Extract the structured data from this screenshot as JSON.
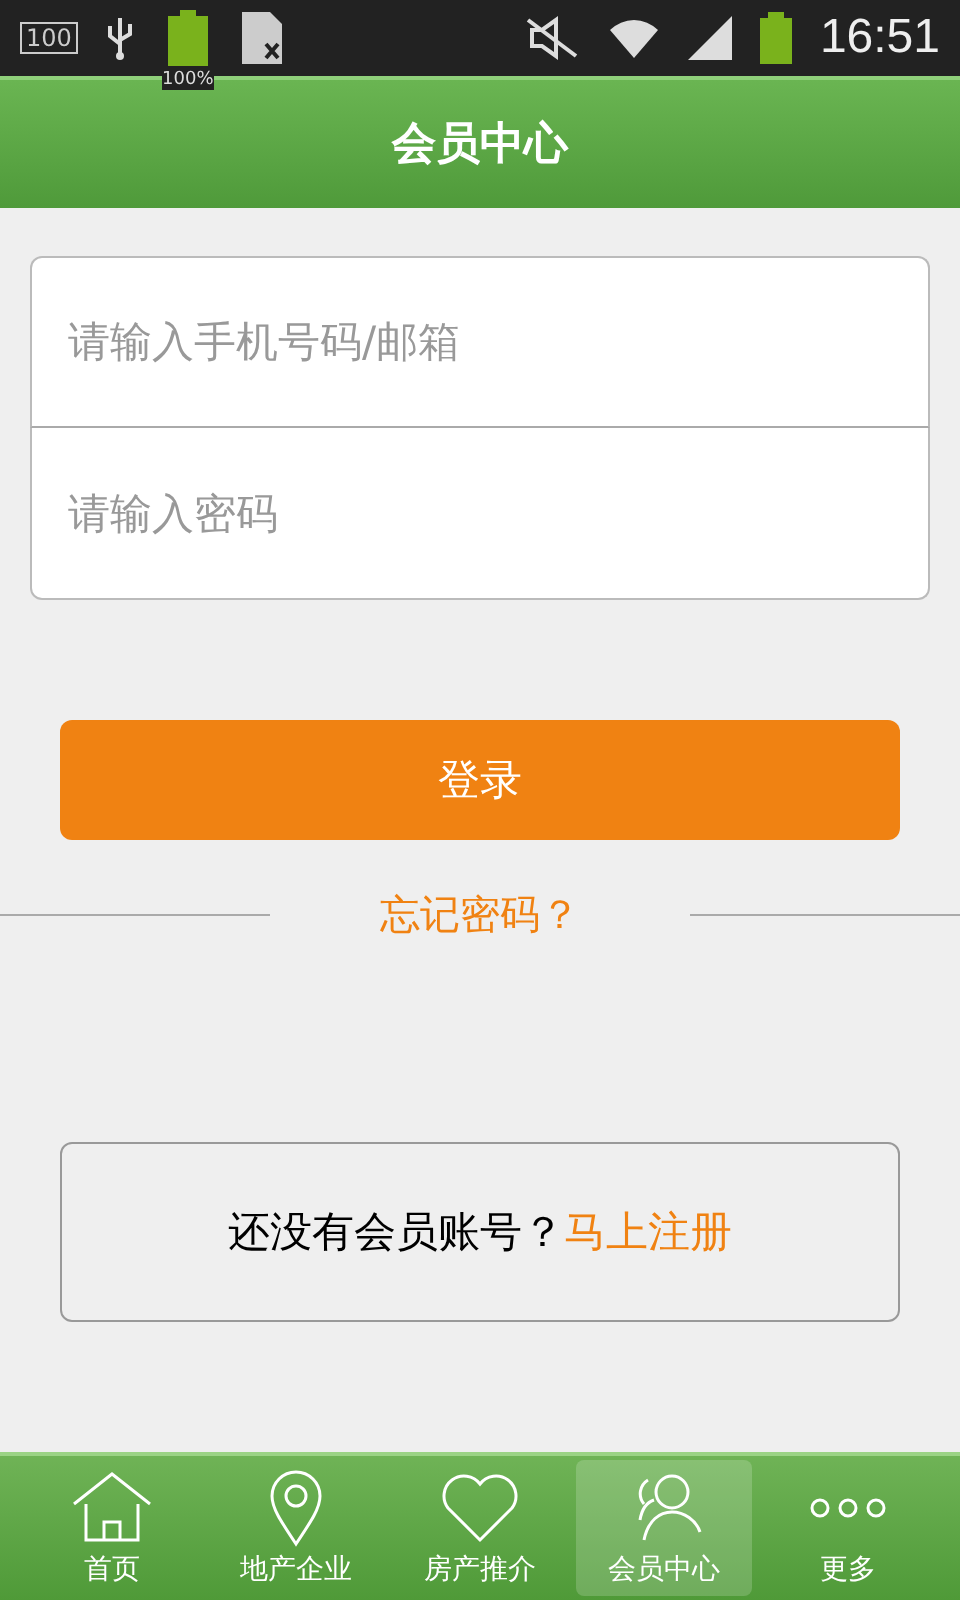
{
  "status_bar": {
    "left_badge": "100",
    "battery_label": "100%",
    "time": "16:51"
  },
  "header": {
    "title": "会员中心"
  },
  "login_form": {
    "fields": [
      {
        "placeholder": "请输入手机号码/邮箱"
      },
      {
        "placeholder": "请输入密码"
      }
    ],
    "login_button": "登录",
    "forgot_link": "忘记密码？"
  },
  "register": {
    "prompt": "还没有会员账号？",
    "link": "马上注册"
  },
  "tabs": [
    {
      "label": "首页",
      "selected": false
    },
    {
      "label": "地产企业",
      "selected": false
    },
    {
      "label": "房产推介",
      "selected": false
    },
    {
      "label": "会员中心",
      "selected": true
    },
    {
      "label": "更多",
      "selected": false
    }
  ]
}
